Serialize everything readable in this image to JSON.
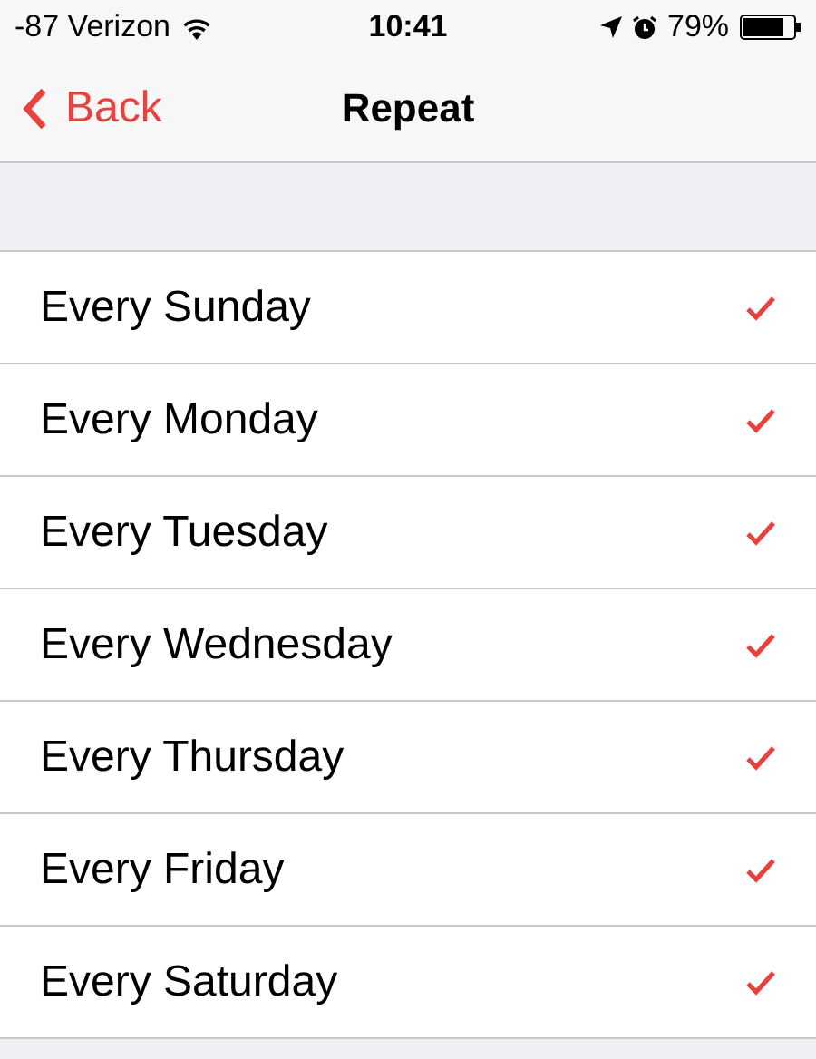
{
  "status_bar": {
    "signal": "-87 Verizon",
    "time": "10:41",
    "battery": "79%"
  },
  "nav_bar": {
    "back": "Back",
    "title": "Repeat"
  },
  "days": [
    {
      "label": "Every Sunday",
      "checked": true
    },
    {
      "label": "Every Monday",
      "checked": true
    },
    {
      "label": "Every Tuesday",
      "checked": true
    },
    {
      "label": "Every Wednesday",
      "checked": true
    },
    {
      "label": "Every Thursday",
      "checked": true
    },
    {
      "label": "Every Friday",
      "checked": true
    },
    {
      "label": "Every Saturday",
      "checked": true
    }
  ]
}
